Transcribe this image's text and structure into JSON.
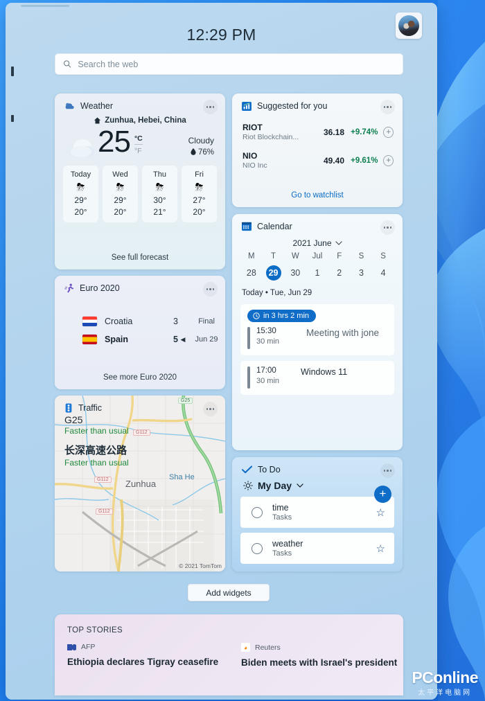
{
  "header": {
    "clock": "12:29 PM",
    "avatar_name": "user-avatar"
  },
  "search": {
    "placeholder": "Search the web",
    "value": "",
    "icon": "search-icon"
  },
  "weather": {
    "title": "Weather",
    "icon": "partly-cloudy-icon",
    "location": "Zunhua, Hebei, China",
    "location_icon": "home-icon",
    "temperature": "25",
    "unit_celsius": "°C",
    "unit_fahrenheit": "°F",
    "condition": "Cloudy",
    "humidity": "76%",
    "humidity_icon": "droplet-icon",
    "forecast": [
      {
        "day": "Today",
        "icon": "thunderstorm-icon",
        "high": "29°",
        "low": "20°"
      },
      {
        "day": "Wed",
        "icon": "thunderstorm-icon",
        "high": "29°",
        "low": "20°"
      },
      {
        "day": "Thu",
        "icon": "thunderstorm-icon",
        "high": "30°",
        "low": "21°"
      },
      {
        "day": "Fri",
        "icon": "thunderstorm-icon",
        "high": "27°",
        "low": "20°"
      }
    ],
    "footer_link": "See full forecast"
  },
  "stocks": {
    "title": "Suggested for you",
    "icon": "chart-bar-icon",
    "rows": [
      {
        "symbol": "RIOT",
        "name": "Riot Blockchain...",
        "price": "36.18",
        "change": "+9.74%",
        "add_icon": "plus-circle-icon"
      },
      {
        "symbol": "NIO",
        "name": "NIO Inc",
        "price": "49.40",
        "change": "+9.61%",
        "add_icon": "plus-circle-icon"
      }
    ],
    "footer_link": "Go to watchlist",
    "positive_color": "#0f8050",
    "link_color": "#0a6cc4"
  },
  "calendar": {
    "title": "Calendar",
    "icon": "calendar-icon",
    "month_label": "2021 June",
    "month_chevron": "chevron-down-icon",
    "day_headers": [
      "M",
      "T",
      "W",
      "Jul",
      "F",
      "S",
      "S"
    ],
    "dates": [
      "28",
      "29",
      "30",
      "1",
      "2",
      "3",
      "4"
    ],
    "selected_date": "29",
    "today_line": "Today • Tue, Jun 29",
    "countdown_badge": "in 3 hrs 2 min",
    "countdown_icon": "clock-icon",
    "events": [
      {
        "time": "15:30",
        "duration": "30 min",
        "title": "Meeting with jone"
      },
      {
        "time": "17:00",
        "duration": "30 min",
        "title": "Windows 11"
      }
    ],
    "accent_color": "#0a6cc4"
  },
  "euro": {
    "title": "Euro 2020",
    "icon": "running-icon",
    "teams": [
      {
        "name": "Croatia",
        "flag": "flag-croatia",
        "score": "3",
        "winner": false
      },
      {
        "name": "Spain",
        "flag": "flag-spain",
        "score": "5",
        "winner": true
      }
    ],
    "status": "Final",
    "date": "Jun 29",
    "footer_link": "See more Euro 2020"
  },
  "traffic": {
    "title": "Traffic",
    "icon": "traffic-light-icon",
    "routes": [
      {
        "road": "G25",
        "status": "Faster than usual"
      },
      {
        "road": "长深高速公路",
        "status": "Faster than usual"
      }
    ],
    "map_labels": [
      "Zunhua",
      "Sha He"
    ],
    "road_shields": [
      "G25",
      "G112",
      "G112",
      "G112"
    ],
    "attribution": "© 2021 TomTom",
    "status_color": "#1f8a3c"
  },
  "todo": {
    "title": "To Do",
    "icon": "check-icon",
    "list_name": "My Day",
    "list_icon": "sun-icon",
    "list_chevron": "chevron-down-icon",
    "add_button": "+",
    "items": [
      {
        "name": "time",
        "sub": "Tasks",
        "checkbox": "circle-checkbox-icon",
        "star": "star-outline-icon"
      },
      {
        "name": "weather",
        "sub": "Tasks",
        "checkbox": "circle-checkbox-icon",
        "star": "star-outline-icon"
      }
    ],
    "accent_color": "#0f6cc7"
  },
  "add_widgets": {
    "label": "Add widgets"
  },
  "stories": {
    "heading": "TOP STORIES",
    "items": [
      {
        "source": "AFP",
        "source_icon": "afp-logo-icon",
        "headline": "Ethiopia declares Tigray ceasefire"
      },
      {
        "source": "Reuters",
        "source_icon": "reuters-logo-icon",
        "headline": "Biden meets with Israel's president"
      }
    ]
  },
  "watermark": {
    "line1": "PConline",
    "line2": "太平洋电脑网"
  }
}
